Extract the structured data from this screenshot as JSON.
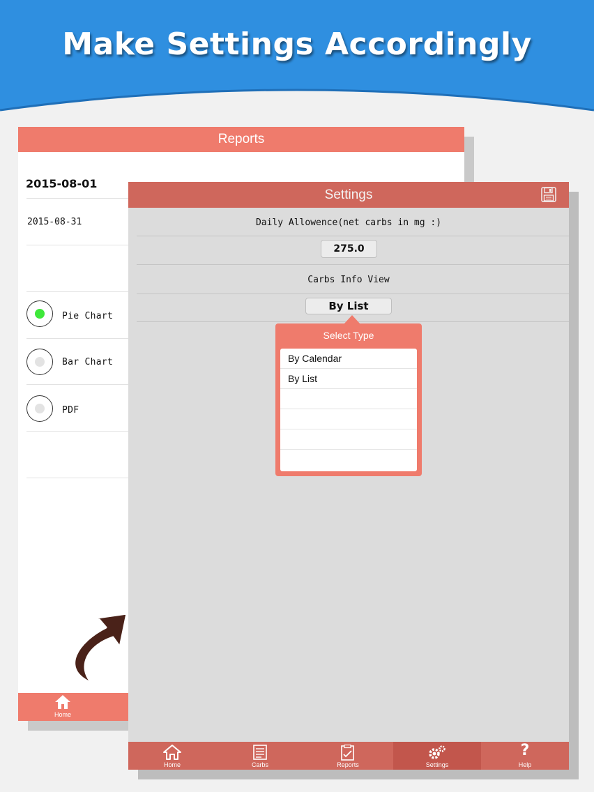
{
  "banner": {
    "title": "Make Settings Accordingly",
    "color": "#2f8fe0"
  },
  "reports_panel": {
    "title": "Reports",
    "start_date": "2015-08-01",
    "end_date": "2015-08-31",
    "options": [
      {
        "label": "Pie Chart",
        "selected": true
      },
      {
        "label": "Bar Chart",
        "selected": false
      },
      {
        "label": "PDF",
        "selected": false
      }
    ],
    "tabbar": {
      "home_label": "Home"
    }
  },
  "settings_panel": {
    "title": "Settings",
    "daily_allowance_label": "Daily Allowence(net carbs in mg :)",
    "daily_allowance_value": "275.0",
    "carbs_info_label": "Carbs Info View",
    "carbs_info_value": "By List",
    "header_color": "#cf675c"
  },
  "popover": {
    "title": "Select Type",
    "options": [
      "By Calendar",
      "By List",
      "",
      "",
      "",
      ""
    ],
    "color": "#ef7b6c"
  },
  "tabbar": {
    "tabs": [
      {
        "label": "Home",
        "icon": "home-icon",
        "active": false
      },
      {
        "label": "Carbs",
        "icon": "document-list-icon",
        "active": false
      },
      {
        "label": "Reports",
        "icon": "report-check-icon",
        "active": false
      },
      {
        "label": "Settings",
        "icon": "gears-icon",
        "active": true
      },
      {
        "label": "Help",
        "icon": "question-icon",
        "active": false
      }
    ]
  }
}
